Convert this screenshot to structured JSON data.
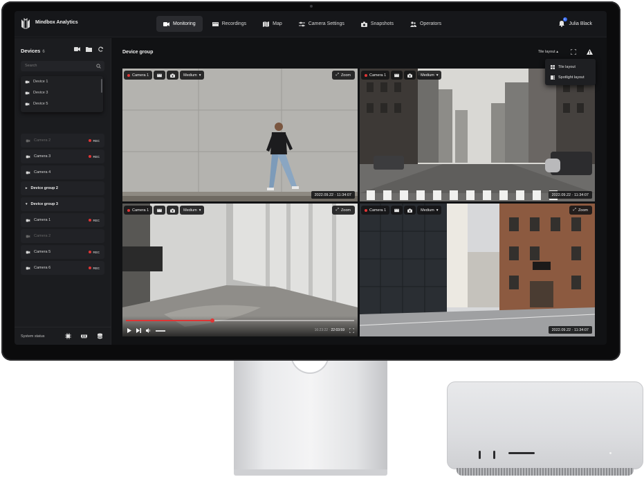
{
  "app": {
    "brand": "Mindbox Analytics"
  },
  "nav": [
    {
      "label": "Monitoring",
      "icon": "video-camera-icon",
      "active": true
    },
    {
      "label": "Recordings",
      "icon": "film-icon",
      "active": false
    },
    {
      "label": "Map",
      "icon": "map-icon",
      "active": false
    },
    {
      "label": "Camera Settings",
      "icon": "sliders-icon",
      "active": false
    },
    {
      "label": "Snapshots",
      "icon": "camera-icon",
      "active": false
    },
    {
      "label": "Operators",
      "icon": "users-icon",
      "active": false
    }
  ],
  "user": {
    "name": "Julia Black",
    "notifications": "1"
  },
  "sidebar": {
    "title": "Devices",
    "count": "6",
    "search_placeholder": "Search",
    "dropdown": [
      "Device 1",
      "Device 3",
      "Device 5"
    ],
    "rows": [
      {
        "type": "camera",
        "label": "Camera 2",
        "rec": "REC",
        "dim": true
      },
      {
        "type": "camera",
        "label": "Camera 3",
        "rec": "REC",
        "dim": false
      },
      {
        "type": "camera",
        "label": "Camera 4",
        "rec": "",
        "dim": false
      },
      {
        "type": "group",
        "label": "Device group 2",
        "caret": "▸"
      },
      {
        "type": "group",
        "label": "Device group 3",
        "caret": "▾"
      },
      {
        "type": "camera",
        "label": "Camera 1",
        "rec": "REC",
        "dim": false
      },
      {
        "type": "camera",
        "label": "Camera 2",
        "rec": "",
        "dim": true
      },
      {
        "type": "camera",
        "label": "Camera 5",
        "rec": "REC",
        "dim": false
      },
      {
        "type": "camera",
        "label": "Camera 6",
        "rec": "REC",
        "dim": false
      }
    ],
    "footer_label": "System status"
  },
  "main": {
    "title": "Device group",
    "layout_label": "Tile layout",
    "layout_menu": [
      "Tile layout",
      "Spotlight layout"
    ]
  },
  "tiles": [
    {
      "camera": "Camera 1",
      "quality": "Medium",
      "zoom": "Zoom",
      "timestamp": "2022.09.22 · 11:34:07",
      "scene": "person-wall"
    },
    {
      "camera": "Camera 1",
      "quality": "Medium",
      "zoom": "Zoom",
      "timestamp": "2022.09.22 · 11:34:07",
      "scene": "street"
    },
    {
      "camera": "Camera 1",
      "quality": "Medium",
      "zoom": "Zoom",
      "timestamp": "",
      "scene": "alley",
      "player": {
        "progress": 0.38,
        "elapsed": "16:23:22",
        "total": "22:03:59"
      }
    },
    {
      "camera": "Camera 1",
      "quality": "Medium",
      "zoom": "Zoom",
      "timestamp": "2022.09.22 · 11:34:07",
      "scene": "buildings"
    }
  ],
  "colors": {
    "rec": "#e03535",
    "accent": "#3b6ff5",
    "screen_bg": "#111214"
  }
}
